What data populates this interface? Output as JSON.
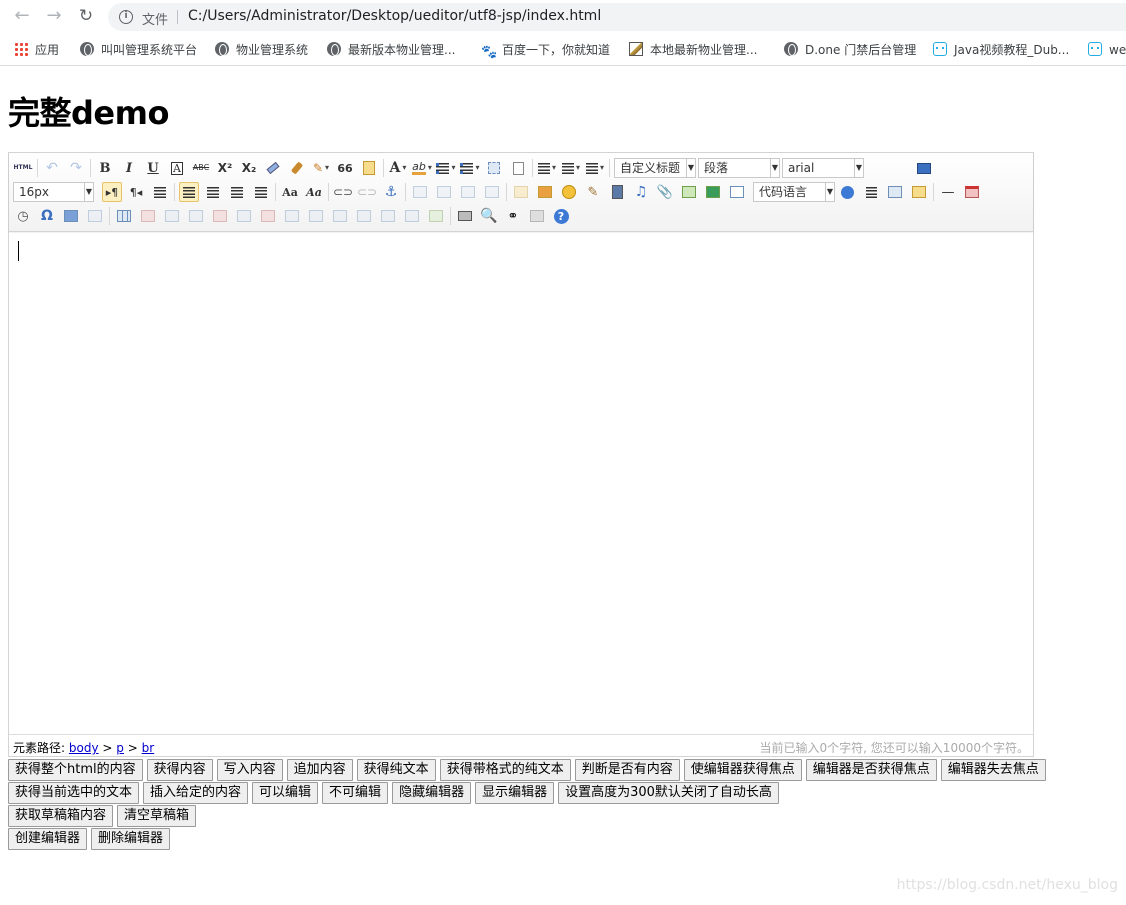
{
  "browser": {
    "back_icon": "arrow-left-icon",
    "forward_icon": "arrow-right-icon",
    "reload_icon": "reload-icon",
    "file_label": "文件",
    "url": "C:/Users/Administrator/Desktop/ueditor/utf8-jsp/index.html",
    "bookmarks": [
      {
        "label": "应用",
        "icon": "apps-grid-icon"
      },
      {
        "label": "叫叫管理系统平台",
        "icon": "globe-icon"
      },
      {
        "label": "物业管理系统",
        "icon": "globe-icon"
      },
      {
        "label": "最新版本物业管理...",
        "icon": "globe-icon"
      },
      {
        "label": "百度一下，你就知道",
        "icon": "baidu-paw-icon"
      },
      {
        "label": "本地最新物业管理...",
        "icon": "image-icon"
      },
      {
        "label": "D.one 门禁后台管理",
        "icon": "globe-icon"
      },
      {
        "label": "Java视频教程_Dub...",
        "icon": "bilibili-icon"
      },
      {
        "label": "we",
        "icon": "bilibili-icon"
      }
    ]
  },
  "page": {
    "title": "完整demo"
  },
  "editor": {
    "combos": {
      "custom_heading": "自定义标题",
      "paragraph": "段落",
      "font_family": "arial",
      "font_size": "16px",
      "code_language": "代码语言"
    },
    "toolbar_text": {
      "html": "HTML",
      "bold": "B",
      "italic": "I",
      "underline": "U",
      "fontborder": "A",
      "strike": "ABC",
      "superscript": "X²",
      "subscript": "X₂",
      "quote": "66",
      "fontcolor": "A",
      "backcolor": "ab",
      "autotypeset_a1": "Aa",
      "autotypeset_a2": "Aa",
      "specialchars": "Ω",
      "help": "?",
      "horizontal": "—"
    },
    "statusbar": {
      "path_label": "元素路径:",
      "path_items": [
        "body",
        "p",
        "br"
      ],
      "path_sep": ">",
      "wordcount": "当前已输入0个字符, 您还可以输入10000个字符。"
    }
  },
  "buttons": {
    "row1": [
      "获得整个html的内容",
      "获得内容",
      "写入内容",
      "追加内容",
      "获得纯文本",
      "获得带格式的纯文本",
      "判断是否有内容",
      "使编辑器获得焦点",
      "编辑器是否获得焦点",
      "编辑器失去焦点"
    ],
    "row2": [
      "获得当前选中的文本",
      "插入给定的内容",
      "可以编辑",
      "不可编辑",
      "隐藏编辑器",
      "显示编辑器",
      "设置高度为300默认关闭了自动长高"
    ],
    "row3": [
      "获取草稿箱内容",
      "清空草稿箱"
    ],
    "row4": [
      "创建编辑器",
      "删除编辑器"
    ]
  },
  "watermark": "https://blog.csdn.net/hexu_blog"
}
